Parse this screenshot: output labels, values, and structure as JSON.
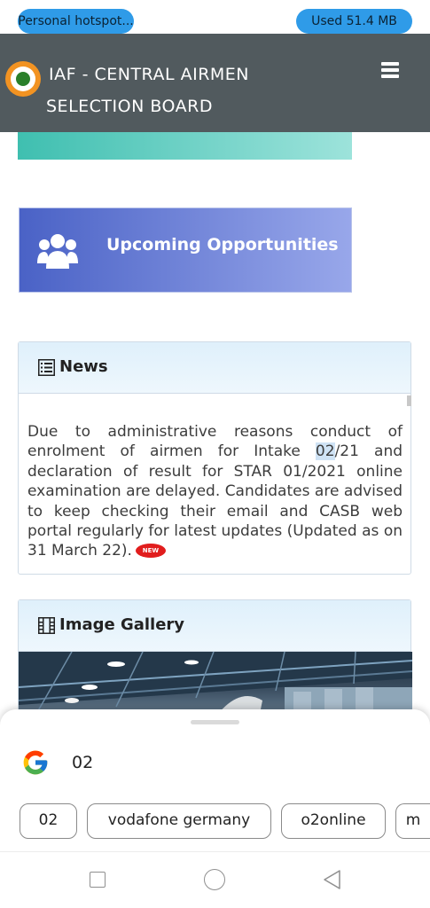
{
  "status_bar": {
    "hotspot_label": "Personal hotspot...",
    "data_usage": "Used  51.4 MB"
  },
  "header": {
    "title_line1": "IAF - CENTRAL AIRMEN",
    "title_line2": "SELECTION BOARD",
    "menu_icon": "hamburger-menu-icon",
    "logo_icon": "iaf-roundel-logo"
  },
  "opportunities": {
    "label": "Upcoming Opportunities",
    "icon": "users-group-icon"
  },
  "news": {
    "heading": "News",
    "icon": "list-icon",
    "text_before": "Due to administrative reasons conduct of enrolment of airmen for Intake ",
    "highlight": "02",
    "text_after": "/21 and declaration of result for STAR 01/2021 online examination are delayed. Candidates are advised to keep checking their email and CASB web portal regularly for latest updates (Updated as on 31 March 22).",
    "badge": "NEW"
  },
  "gallery": {
    "heading": "Image Gallery",
    "icon": "film-icon"
  },
  "search_sheet": {
    "engine_icon": "google-icon",
    "query": "02",
    "suggestions": [
      "02",
      "vodafone germany",
      "o2online",
      "m"
    ]
  },
  "nav_bar": {
    "icons": [
      "recents-square-icon",
      "home-circle-icon",
      "back-triangle-icon"
    ]
  },
  "colors": {
    "header_bg": "#515a5e",
    "status_pill": "#2f9be8",
    "opportunities_start": "#4a62c6",
    "opportunities_end": "#98a7ea",
    "teal": "#3fbfb0",
    "card_border": "#cfdbe6"
  }
}
